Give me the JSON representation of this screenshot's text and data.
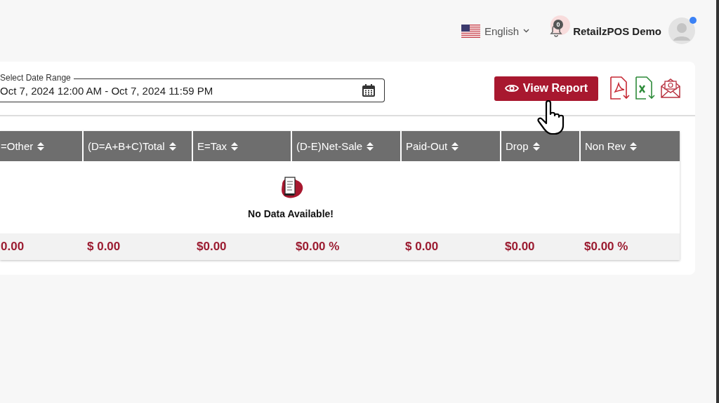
{
  "header": {
    "language": "English",
    "notification_count": "0",
    "user_name": "RetailzPOS Demo",
    "user_online": true
  },
  "filter": {
    "label": "Select Date Range",
    "value": "Oct 7, 2024 12:00 AM - Oct 7, 2024 11:59 PM"
  },
  "actions": {
    "view_report": "View Report"
  },
  "table": {
    "columns": [
      {
        "label": "=Other"
      },
      {
        "label": "(D=A+B+C)Total"
      },
      {
        "label": "E=Tax"
      },
      {
        "label": "(D-E)Net-Sale"
      },
      {
        "label": "Paid-Out"
      },
      {
        "label": "Drop"
      },
      {
        "label": "Non Rev"
      }
    ],
    "empty_message": "No Data Available!",
    "totals": [
      "0.00",
      "$ 0.00",
      "$0.00",
      "$0.00 %",
      "$ 0.00",
      "$0.00",
      "$0.00 %"
    ]
  }
}
